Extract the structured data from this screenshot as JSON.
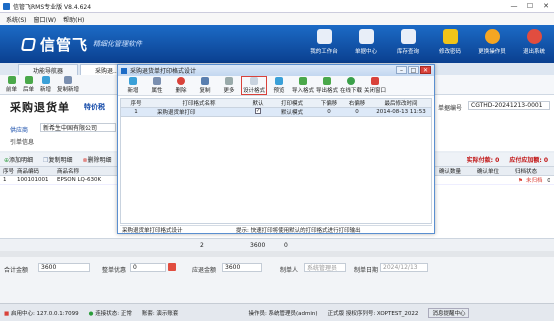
{
  "window": {
    "title": "信管飞RMS专业版 V8.4.624",
    "min": "—",
    "max": "☐",
    "close": "✕"
  },
  "menu": [
    "系统(S)",
    "窗口(W)",
    "帮助(H)"
  ],
  "banner": {
    "brand": "信管飞",
    "slogan": "精细化管理软件",
    "buttons": [
      {
        "label": "我的工作台",
        "color": "#e8eef8"
      },
      {
        "label": "单据中心",
        "color": "#e8eef8"
      },
      {
        "label": "库存查询",
        "color": "#e8eef8"
      },
      {
        "label": "修改密码",
        "color": "#f0c419"
      },
      {
        "label": "更换操作员",
        "color": "#f5a623"
      },
      {
        "label": "退出系统",
        "color": "#e14d3f"
      }
    ]
  },
  "tabs": [
    "功能导航器",
    "采购退..."
  ],
  "toolbar": [
    "前单",
    "后单",
    "新增",
    "复制新增"
  ],
  "form": {
    "title": "采购退货单",
    "type": "特价税",
    "order_no_label": "单据编号",
    "order_no": "CGTHD-20241213-0001",
    "supplier_label": "供应商",
    "supplier": "新希生中国有限公司",
    "warehouse_label": "引单信息"
  },
  "sumbar": {
    "add_detail": "添加明细",
    "copy_detail": "复制明细",
    "delete_detail": "删除明细",
    "paid": "实际付款: 0",
    "payable": "应付应加额: 0"
  },
  "grid": {
    "headers": [
      "序号",
      "商品编码",
      "商品名称",
      "确认数量",
      "确认单位",
      "归档状态"
    ],
    "rows": [
      {
        "no": "1",
        "code": "100101001",
        "name": "EPSON LQ-630K",
        "qty": "",
        "unit": "",
        "status": "未归档",
        "status_num": "0"
      }
    ]
  },
  "footer": {
    "qty": "2",
    "amount": "3600",
    "zero": "0"
  },
  "bottom": {
    "total_label": "合计金额",
    "total": "3600",
    "discount_label": "整单优惠",
    "discount": "0",
    "due_label": "应退金额",
    "due": "3600",
    "maker_label": "制单人",
    "maker": "系统管理员",
    "date_label": "制单日期",
    "date": "2024/12/13"
  },
  "status": {
    "app": "启用中心: 127.0.0.1:7099",
    "conn": "连接状态: 正常",
    "account": "账套: 演示账套",
    "operator": "操作员: 系统管理员(admin)",
    "license": "正式版 授权序列号: XOPTEST_2022",
    "center": "消息提醒中心"
  },
  "modal": {
    "title": "采购退货单打印格式设计",
    "tools": [
      "新增",
      "属性",
      "删除",
      "复制",
      "更多",
      "设计格式",
      "预览",
      "导入格式",
      "导出格式",
      "在线下载",
      "关闭窗口"
    ],
    "headers": [
      "序号",
      "打印格式名称",
      "默认",
      "打印模式",
      "下偏移",
      "右偏移",
      "最后修改时间"
    ],
    "rows": [
      {
        "no": "1",
        "name": "采购退货单打印",
        "default": "✓",
        "mode": "默认模式",
        "down": "0",
        "right": "0",
        "time": "2014-08-13 11:53"
      }
    ],
    "status_left": "采购退货单打印格式设计",
    "status_right": "提示: 快速打印将使用默认的打印格式进行打印输出"
  }
}
